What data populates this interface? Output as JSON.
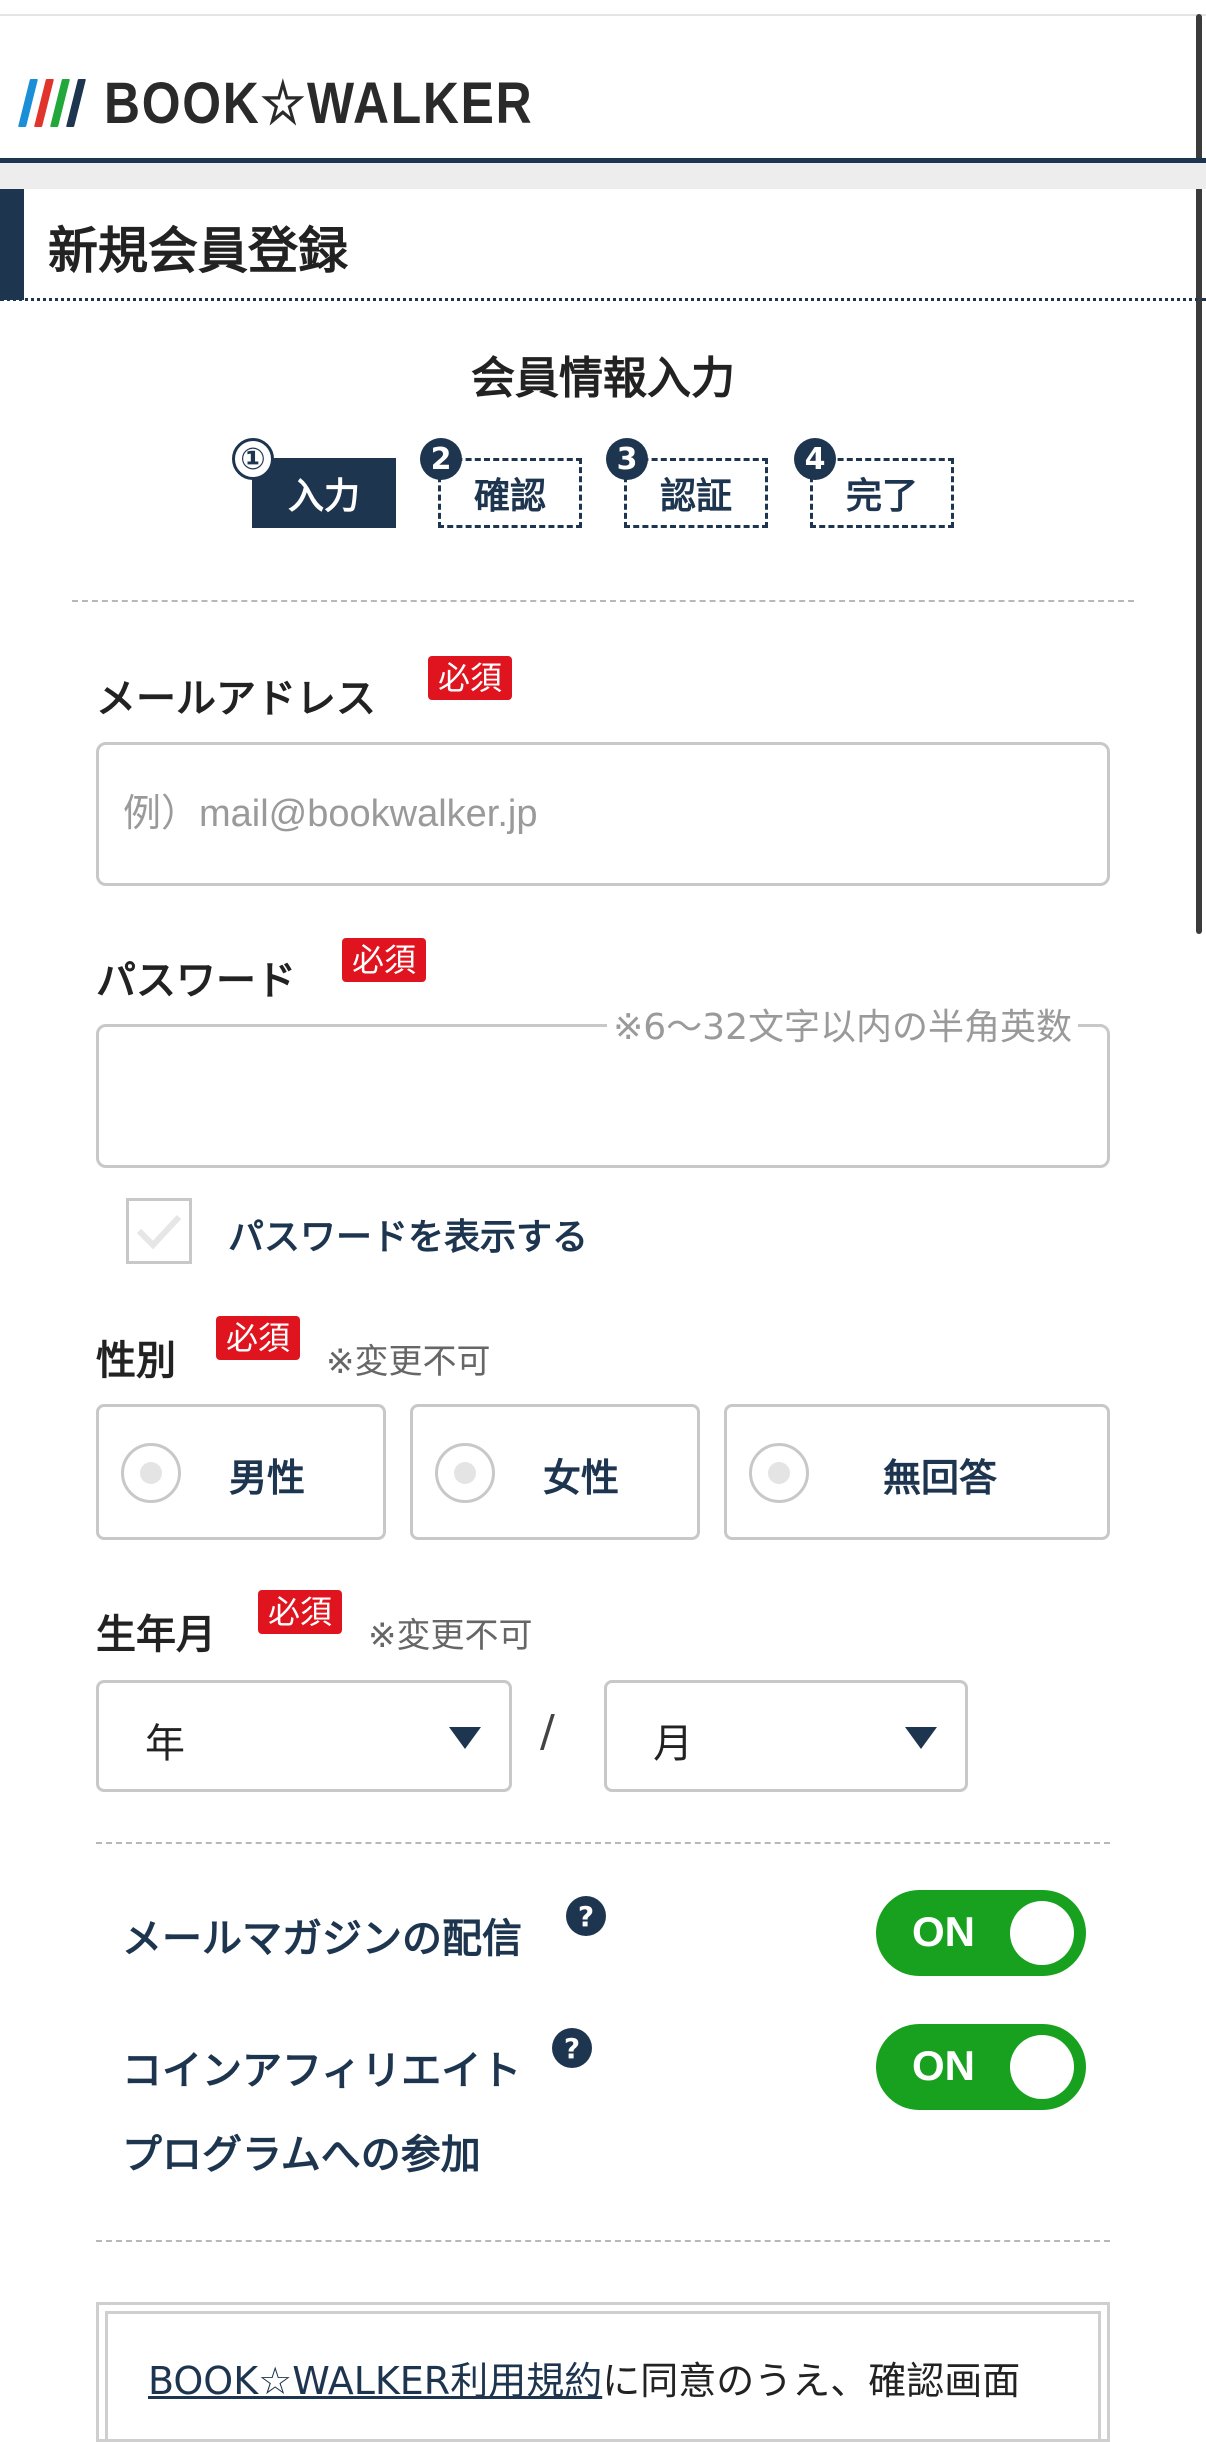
{
  "header": {
    "logo_text": "BOOK☆WALKER",
    "logo_bar_colors": [
      "#1a8fd8",
      "#e1342c",
      "#22a83a",
      "#1e3550"
    ]
  },
  "page": {
    "title": "新規会員登録",
    "section_title": "会員情報入力"
  },
  "steps": [
    {
      "number": "①",
      "label": "入力",
      "active": true
    },
    {
      "number": "2",
      "label": "確認",
      "active": false
    },
    {
      "number": "3",
      "label": "認証",
      "active": false
    },
    {
      "number": "4",
      "label": "完了",
      "active": false
    }
  ],
  "form": {
    "required_badge": "必須",
    "email": {
      "label": "メールアドレス",
      "placeholder": "例）mail@bookwalker.jp",
      "value": ""
    },
    "password": {
      "label": "パスワード",
      "hint": "※6〜32文字以内の半角英数",
      "value": "",
      "show_password_label": "パスワードを表示する"
    },
    "gender": {
      "label": "性別",
      "note": "※変更不可",
      "options": [
        "男性",
        "女性",
        "無回答"
      ]
    },
    "birth": {
      "label": "生年月",
      "note": "※変更不可",
      "year_placeholder": "年",
      "separator": "/",
      "month_placeholder": "月"
    },
    "mail_magazine": {
      "label": "メールマガジンの配信",
      "state": "ON",
      "help": "?"
    },
    "coin_affiliate": {
      "label_line1": "コインアフィリエイト",
      "label_line2": "プログラムへの参加",
      "state": "ON",
      "help": "?"
    }
  },
  "terms": {
    "link_text": "BOOK☆WALKER利用規約",
    "text": "に同意のうえ、確認画面"
  },
  "colors": {
    "navy": "#1e3550",
    "required_red": "#e0141e",
    "toggle_green": "#17a11f"
  }
}
